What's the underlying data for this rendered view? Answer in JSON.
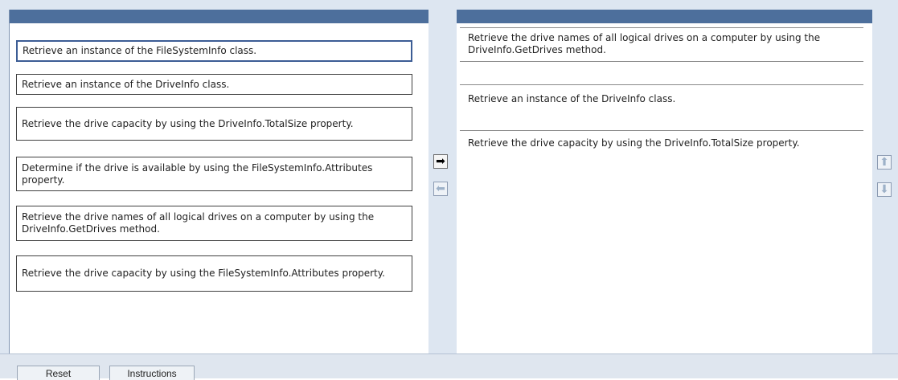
{
  "source_list": {
    "items": [
      "Retrieve an instance of the FileSystemInfo class.",
      "Retrieve an instance of the DriveInfo class.",
      "Retrieve the drive capacity by using the DriveInfo.TotalSize property.",
      "Determine if the drive is available by using the FileSystemInfo.Attributes property.",
      "Retrieve the drive names of all logical drives on a computer by using the DriveInfo.GetDrives method.",
      "Retrieve the drive capacity by using the FileSystemInfo.Attributes property."
    ],
    "selected_index": 0
  },
  "target_list": {
    "slots": [
      "Retrieve the drive names of all logical drives on a computer by using the DriveInfo.GetDrives method.",
      "Retrieve an instance of the DriveInfo class.",
      "Retrieve the drive capacity by using the DriveInfo.TotalSize property."
    ]
  },
  "transfer_controls": {
    "move_right_icon": "arrow-right-icon",
    "move_left_icon": "arrow-left-icon",
    "move_up_icon": "arrow-up-icon",
    "move_down_icon": "arrow-down-icon"
  },
  "footer": {
    "reset_label": "Reset",
    "instructions_label": "Instructions"
  }
}
